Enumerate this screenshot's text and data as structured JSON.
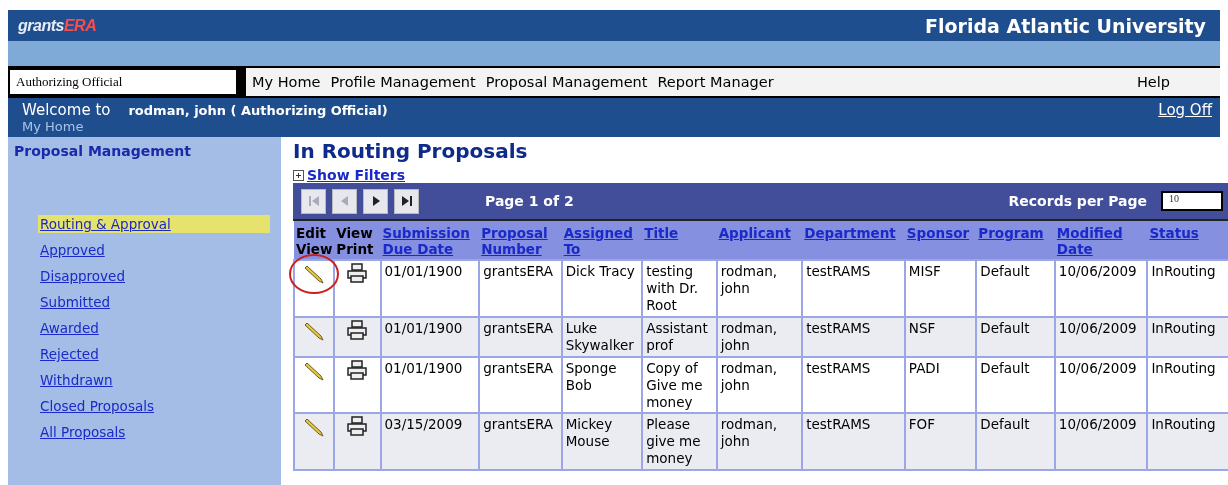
{
  "header": {
    "logo_left": "grants",
    "logo_right": "ERA",
    "institution": "Florida Atlantic University"
  },
  "role_select": {
    "value": "Authorizing Official"
  },
  "menu": [
    "My Home",
    "Profile Management",
    "Proposal Management",
    "Report Manager"
  ],
  "help": "Help",
  "welcome": {
    "label": "Welcome to",
    "user_line": "rodman, john ( Authorizing Official)",
    "breadcrumb": "My Home",
    "logoff": "Log Off"
  },
  "sidebar": {
    "title": "Proposal Management",
    "items": [
      {
        "label": "Routing & Approval",
        "selected": true
      },
      {
        "label": "Approved",
        "selected": false
      },
      {
        "label": "Disapproved",
        "selected": false
      },
      {
        "label": "Submitted",
        "selected": false
      },
      {
        "label": "Awarded",
        "selected": false
      },
      {
        "label": "Rejected",
        "selected": false
      },
      {
        "label": "Withdrawn",
        "selected": false
      },
      {
        "label": "Closed Proposals",
        "selected": false
      },
      {
        "label": "All Proposals",
        "selected": false
      }
    ]
  },
  "page_title": "In Routing Proposals",
  "show_filters": "Show Filters",
  "pager": {
    "page_label": "Page 1 of 2",
    "records_label": "Records per Page",
    "records_value": "10"
  },
  "table": {
    "columns": [
      {
        "label": "Edit View",
        "kind": "edit"
      },
      {
        "label": "View Print",
        "kind": "print"
      },
      {
        "label": "Submission Due Date",
        "kind": "link"
      },
      {
        "label": "Proposal Number",
        "kind": "link"
      },
      {
        "label": "Assigned To",
        "kind": "link"
      },
      {
        "label": "Title",
        "kind": "link"
      },
      {
        "label": "Applicant",
        "kind": "link"
      },
      {
        "label": "Department",
        "kind": "link"
      },
      {
        "label": "Sponsor",
        "kind": "link"
      },
      {
        "label": "Program",
        "kind": "link"
      },
      {
        "label": "Modified Date",
        "kind": "link"
      },
      {
        "label": "Status",
        "kind": "link"
      }
    ],
    "rows": [
      {
        "circled": true,
        "cells": [
          "",
          "",
          "01/01/1900",
          "grantsERA",
          "Dick Tracy",
          "testing with Dr. Root",
          "rodman, john",
          "testRAMS",
          "MISF",
          "Default",
          "10/06/2009",
          "InRouting"
        ]
      },
      {
        "circled": false,
        "cells": [
          "",
          "",
          "01/01/1900",
          "grantsERA",
          "Luke Skywalker",
          "Assistant prof",
          "rodman, john",
          "testRAMS",
          "NSF",
          "Default",
          "10/06/2009",
          "InRouting"
        ]
      },
      {
        "circled": false,
        "cells": [
          "",
          "",
          "01/01/1900",
          "grantsERA",
          "Sponge Bob",
          "Copy of Give me money",
          "rodman, john",
          "testRAMS",
          "PADI",
          "Default",
          "10/06/2009",
          "InRouting"
        ]
      },
      {
        "circled": false,
        "cells": [
          "",
          "",
          "03/15/2009",
          "grantsERA",
          "Mickey Mouse",
          "Please give me money",
          "rodman, john",
          "testRAMS",
          "FOF",
          "Default",
          "10/06/2009",
          "InRouting"
        ]
      }
    ]
  }
}
